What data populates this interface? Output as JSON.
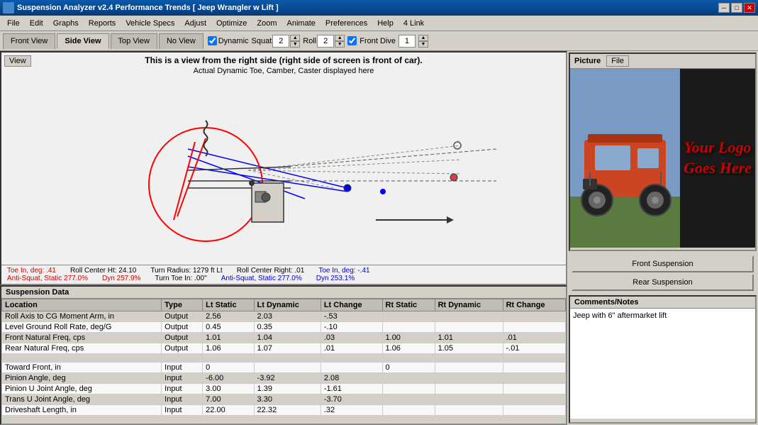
{
  "titlebar": {
    "title": "Suspension Analyzer v2.4   Performance Trends   [ Jeep Wrangler w Lift ]",
    "min_label": "─",
    "max_label": "□",
    "close_label": "✕"
  },
  "menu": {
    "items": [
      "File",
      "Edit",
      "Graphs",
      "Reports",
      "Vehicle Specs",
      "Adjust",
      "Optimize",
      "Zoom",
      "Animate",
      "Preferences",
      "Help",
      "4 Link"
    ]
  },
  "tabs": {
    "views": [
      "Front View",
      "Side View",
      "Top View",
      "No View"
    ],
    "active": "Side View",
    "dynamic_label": "Dynamic",
    "squat_label": "Squat",
    "squat_value": "2",
    "roll_label": "Roll",
    "roll_value": "2",
    "front_dive_label": "Front Dive",
    "front_dive_value": "1",
    "front_dive_checked": true
  },
  "view": {
    "label": "View",
    "title": "This is a view from the right side (right side of screen is front of car).",
    "subtitle": "Actual Dynamic Toe, Camber, Caster displayed here"
  },
  "status": {
    "toe_in_label": "Toe In, deg: .41",
    "roll_center_ht": "Roll Center Ht: 24.10",
    "turn_radius": "Turn Radius: 1279 ft Lt",
    "roll_center_right": "Roll Center Right: .01",
    "toe_in_right": "Toe In, deg: -.41",
    "anti_squat_left": "Anti-Squat, Static 277.0%",
    "dyn_left": "Dyn 257.9%",
    "turn_toe": "Turn Toe In: .00''",
    "anti_squat_right": "Anti-Squat, Static 277.0%",
    "dyn_right": "Dyn 253.1%"
  },
  "suspension_data": {
    "title": "Suspension Data",
    "columns": [
      "Location",
      "Type",
      "Lt Static",
      "Lt Dynamic",
      "Lt Change",
      "Rt Static",
      "Rt Dynamic",
      "Rt Change"
    ],
    "rows": [
      [
        "Roll Axis to CG Moment Arm, in",
        "Output",
        "2.56",
        "2.03",
        "-.53",
        "",
        "",
        ""
      ],
      [
        "Level Ground Roll Rate, deg/G",
        "Output",
        "0.45",
        "0.35",
        "-.10",
        "",
        "",
        ""
      ],
      [
        "Front Natural Freq, cps",
        "Output",
        "1.01",
        "1.04",
        ".03",
        "1.00",
        "1.01",
        ".01"
      ],
      [
        "Rear Natural Freq, cps",
        "Output",
        "1.06",
        "1.07",
        ".01",
        "1.06",
        "1.05",
        "-.01"
      ],
      [
        "",
        "",
        "",
        "",
        "",
        "",
        "",
        ""
      ],
      [
        "Toward Front, in",
        "Input",
        "0",
        "",
        "",
        "0",
        "",
        ""
      ],
      [
        "Pinion Angle, deg",
        "Input",
        "-6.00",
        "-3.92",
        "2.08",
        "",
        "",
        ""
      ],
      [
        "Pinion U Joint Angle, deg",
        "Input",
        "3.00",
        "1.39",
        "-1.61",
        "",
        "",
        ""
      ],
      [
        "Trans U Joint Angle, deg",
        "Input",
        "7.00",
        "3.30",
        "-3.70",
        "",
        "",
        ""
      ],
      [
        "Driveshaft Length, in",
        "Input",
        "22.00",
        "22.32",
        ".32",
        "",
        "",
        ""
      ]
    ]
  },
  "picture": {
    "title": "Picture",
    "file_btn": "File"
  },
  "logo": {
    "line1": "Your Logo",
    "line2": "Goes Here"
  },
  "suspension_buttons": {
    "front": "Front Suspension",
    "rear": "Rear Suspension"
  },
  "comments": {
    "title": "Comments/Notes",
    "content": "Jeep with 6\" aftermarket lift"
  }
}
